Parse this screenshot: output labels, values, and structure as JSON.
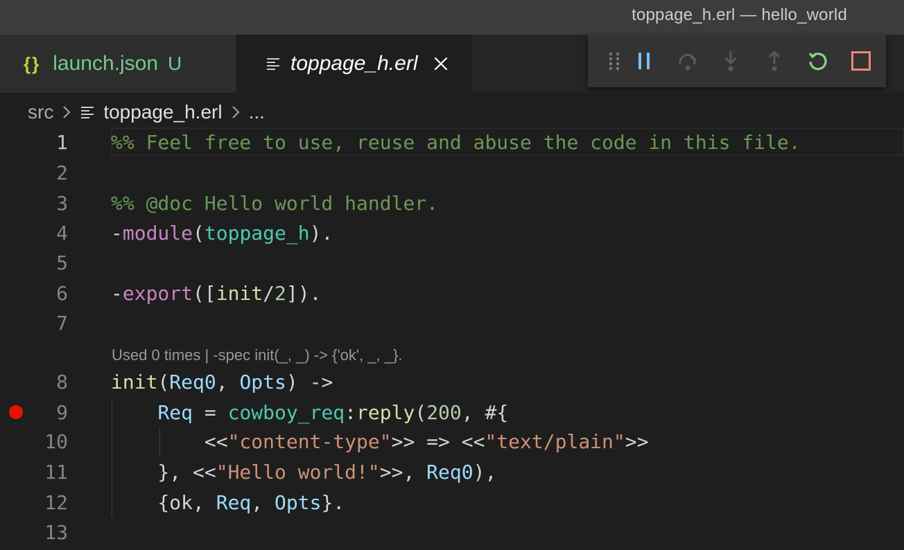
{
  "window": {
    "title": "toppage_h.erl — hello_world"
  },
  "tabs": [
    {
      "icon": "{}",
      "label": "launch.json",
      "badge": "U"
    },
    {
      "label": "toppage_h.erl"
    }
  ],
  "breadcrumb": {
    "folder": "src",
    "file": "toppage_h.erl",
    "tail": "..."
  },
  "debug_toolbar": {
    "buttons": [
      "drag-handle",
      "pause",
      "step-over",
      "step-into",
      "step-out",
      "restart",
      "stop"
    ],
    "colors": {
      "pause": "#75beff",
      "restart": "#89d185",
      "stop": "#f48771",
      "disabled": "#5a5a5a"
    }
  },
  "code_lens": "Used 0 times | -spec init(_, _) -> {'ok', _, _}.",
  "editor": {
    "breakpoint_line": "9",
    "lines": [
      {
        "num": "1",
        "tokens": [
          {
            "t": "%% Feel free to use, reuse and abuse the code in this file.",
            "c": "comment"
          }
        ]
      },
      {
        "num": "2",
        "tokens": []
      },
      {
        "num": "3",
        "tokens": [
          {
            "t": "%% @doc Hello world handler.",
            "c": "comment"
          }
        ]
      },
      {
        "num": "4",
        "tokens": [
          {
            "t": "-",
            "c": "plain"
          },
          {
            "t": "module",
            "c": "attr"
          },
          {
            "t": "(",
            "c": "plain"
          },
          {
            "t": "toppage_h",
            "c": "atom"
          },
          {
            "t": ").",
            "c": "plain"
          }
        ]
      },
      {
        "num": "5",
        "tokens": []
      },
      {
        "num": "6",
        "tokens": [
          {
            "t": "-",
            "c": "plain"
          },
          {
            "t": "export",
            "c": "attr"
          },
          {
            "t": "([",
            "c": "plain"
          },
          {
            "t": "init",
            "c": "func"
          },
          {
            "t": "/",
            "c": "plain"
          },
          {
            "t": "2",
            "c": "num"
          },
          {
            "t": "]).",
            "c": "plain"
          }
        ]
      },
      {
        "num": "7",
        "tokens": []
      },
      {
        "num": "8",
        "tokens": [
          {
            "t": "init",
            "c": "func"
          },
          {
            "t": "(",
            "c": "plain"
          },
          {
            "t": "Req0",
            "c": "var"
          },
          {
            "t": ", ",
            "c": "plain"
          },
          {
            "t": "Opts",
            "c": "var"
          },
          {
            "t": ") ->",
            "c": "plain"
          }
        ]
      },
      {
        "num": "9",
        "tokens": [
          {
            "t": "    ",
            "c": "plain"
          },
          {
            "t": "Req",
            "c": "var"
          },
          {
            "t": " = ",
            "c": "plain"
          },
          {
            "t": "cowboy_req",
            "c": "atom"
          },
          {
            "t": ":",
            "c": "plain"
          },
          {
            "t": "reply",
            "c": "func"
          },
          {
            "t": "(",
            "c": "plain"
          },
          {
            "t": "200",
            "c": "num"
          },
          {
            "t": ", #{",
            "c": "plain"
          }
        ]
      },
      {
        "num": "10",
        "tokens": [
          {
            "t": "        <<",
            "c": "plain"
          },
          {
            "t": "\"content-type\"",
            "c": "str"
          },
          {
            "t": ">> => <<",
            "c": "plain"
          },
          {
            "t": "\"text/plain\"",
            "c": "str"
          },
          {
            "t": ">>",
            "c": "plain"
          }
        ]
      },
      {
        "num": "11",
        "tokens": [
          {
            "t": "    }, <<",
            "c": "plain"
          },
          {
            "t": "\"Hello world!\"",
            "c": "str"
          },
          {
            "t": ">>, ",
            "c": "plain"
          },
          {
            "t": "Req0",
            "c": "var"
          },
          {
            "t": "),",
            "c": "plain"
          }
        ]
      },
      {
        "num": "12",
        "tokens": [
          {
            "t": "    {ok, ",
            "c": "plain"
          },
          {
            "t": "Req",
            "c": "var"
          },
          {
            "t": ", ",
            "c": "plain"
          },
          {
            "t": "Opts",
            "c": "var"
          },
          {
            "t": "}.",
            "c": "plain"
          }
        ]
      },
      {
        "num": "13",
        "tokens": []
      }
    ]
  }
}
